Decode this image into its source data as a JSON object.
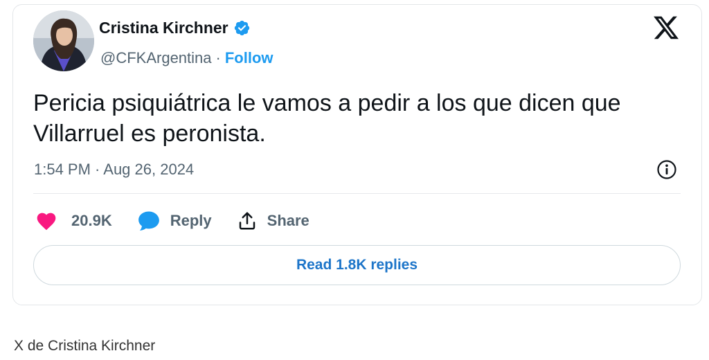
{
  "author": {
    "name": "Cristina Kirchner",
    "handle": "@CFKArgentina",
    "separator": "·",
    "follow_label": "Follow"
  },
  "tweet": {
    "text": "Pericia psiquiátrica le vamos a pedir a los que dicen que Villarruel es peronista.",
    "timestamp": "1:54 PM · Aug 26, 2024"
  },
  "actions": {
    "likes": "20.9K",
    "reply_label": "Reply",
    "share_label": "Share"
  },
  "replies_button": "Read 1.8K replies",
  "caption": "X de Cristina Kirchner",
  "icons": {
    "brand": "x-logo",
    "verified": "verified-badge-icon",
    "like": "heart-icon",
    "reply": "speech-bubble-icon",
    "share": "share-upload-icon",
    "info": "info-icon"
  },
  "colors": {
    "accent": "#1d9bf0",
    "like": "#f91880",
    "reply_icon": "#1d9bf0",
    "muted": "#536471"
  }
}
